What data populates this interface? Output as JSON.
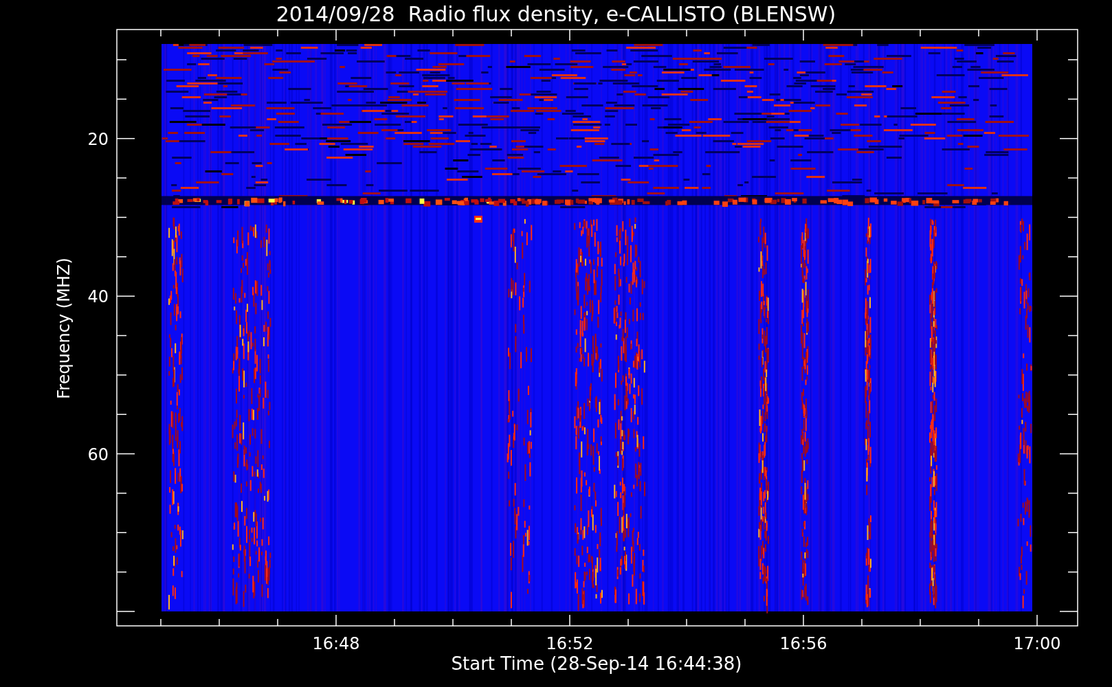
{
  "title": "2014/09/28  Radio flux density, e-CALLISTO (BLENSW)",
  "y_axis": {
    "label": "Frequency (MHZ)",
    "ticks": [
      "20",
      "40",
      "60"
    ]
  },
  "x_axis": {
    "label": "Start Time (28-Sep-14 16:44:38)",
    "ticks": [
      "16:48",
      "16:52",
      "16:56",
      "17:00"
    ]
  }
}
